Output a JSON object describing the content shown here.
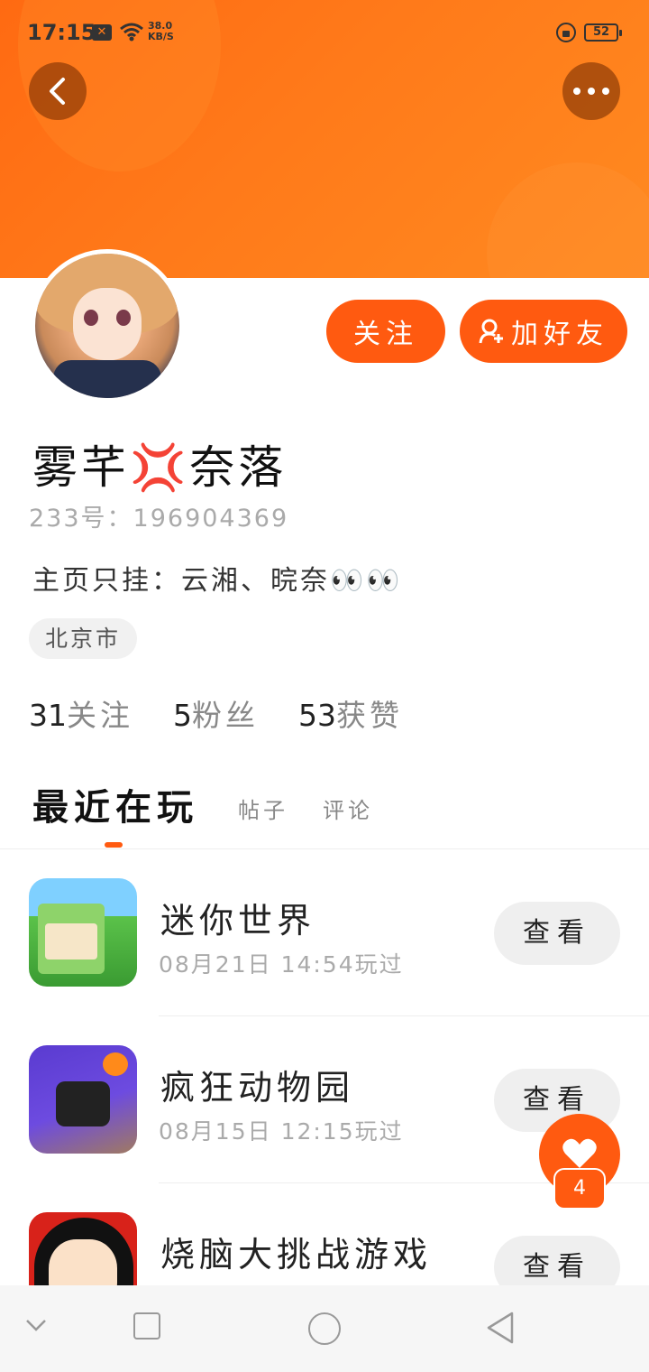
{
  "status_bar": {
    "time": "17:15",
    "network_speed_top": "38.0",
    "network_speed_unit": "KB/S",
    "battery": "52"
  },
  "header": {
    "back_icon": "chevron-left-icon",
    "more_icon": "more-horizontal-icon",
    "accent_color": "#ff6a12"
  },
  "actions": {
    "follow_label": "关注",
    "add_friend_label": "加好友"
  },
  "profile": {
    "name": "雾芊💢奈落",
    "uid_text": "233号：196904369",
    "bio": "主页只挂：云湘、晥奈👀👀",
    "location": "北京市",
    "stats": [
      {
        "count": "31",
        "label": "关注"
      },
      {
        "count": "5",
        "label": "粉丝"
      },
      {
        "count": "53",
        "label": "获赞"
      }
    ]
  },
  "tabs": {
    "active": "最近在玩",
    "posts": "帖子",
    "comments": "评论"
  },
  "games": [
    {
      "title": "迷你世界",
      "played": "08月21日 14:54玩过",
      "button": "查看"
    },
    {
      "title": "疯狂动物园",
      "played": "08月15日 12:15玩过",
      "button": "查看"
    },
    {
      "title": "烧脑大挑战游戏",
      "played": "",
      "button": "查看"
    }
  ],
  "like": {
    "count": "4"
  }
}
